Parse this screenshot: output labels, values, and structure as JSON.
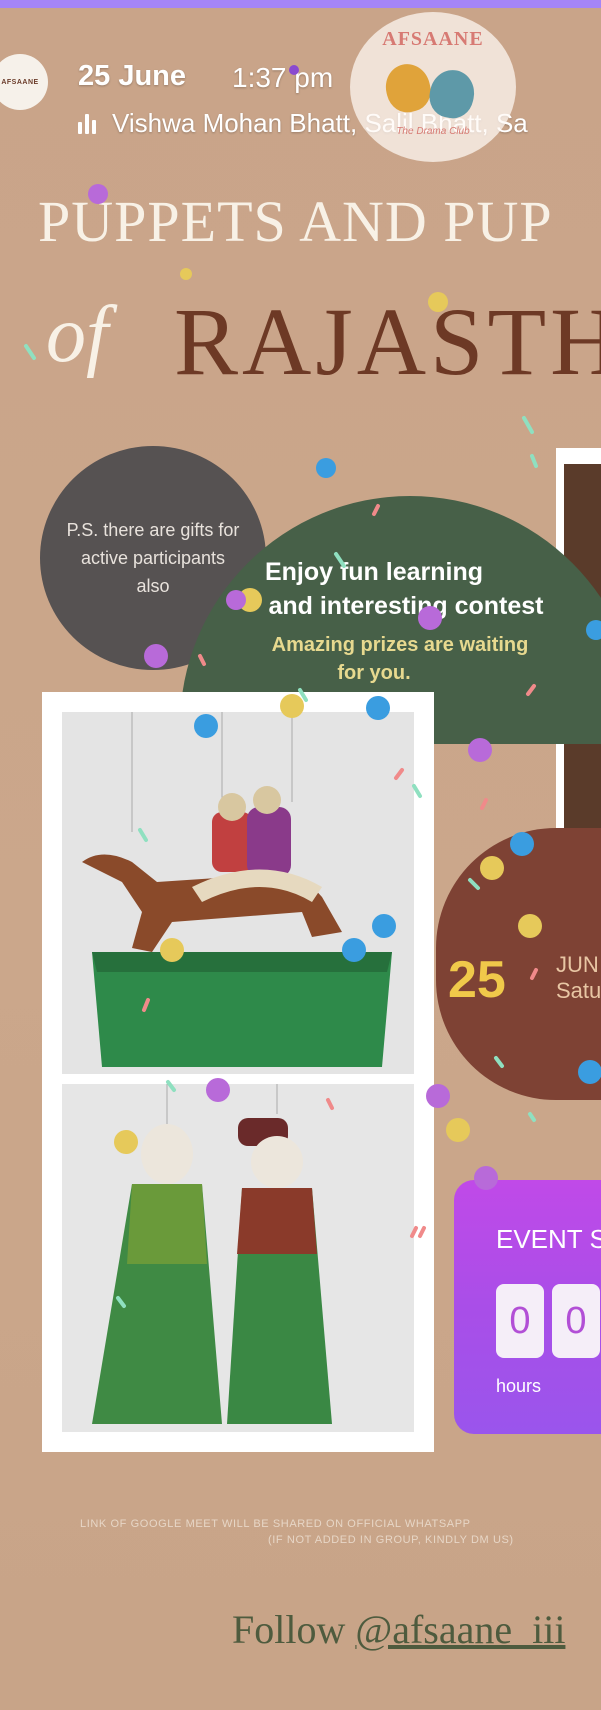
{
  "story": {
    "progress_color": "#a585f6",
    "date": "25 June",
    "time": "1:37 pm",
    "song": "Vishwa Mohan Bhatt, Salil Bhatt, Sa",
    "avatar_text": "AFSAANE"
  },
  "poster": {
    "logo": {
      "name": "AFSAANE",
      "subtitle": "The Drama Club"
    },
    "title_line1": "PUPPETS AND PUP",
    "title_of": "of",
    "title_line2": "RAJASTH",
    "ps_note": "P.S. there are gifts for active participants also",
    "green_panel": {
      "line1": "Enjoy fun learning",
      "line2": "and interesting contest",
      "line3": "Amazing prizes are waiting",
      "line4": "for you."
    },
    "date_panel": {
      "day": "25",
      "month": "JUN",
      "weekday": "Satu"
    },
    "countdown": {
      "title": "EVENT ST",
      "digits": [
        "0",
        "0"
      ],
      "unit": "hours"
    },
    "notice_line1": "LINK OF GOOGLE MEET WILL BE SHARED ON OFFICIAL WHATSAPP",
    "notice_line2": "(IF NOT ADDED IN GROUP, KINDLY DM US)",
    "follow_prefix": "Follow ",
    "follow_handle": "@afsaane_iii"
  },
  "colors": {
    "background": "#c9a489",
    "green_panel": "#476048",
    "ps_circle": "#565252",
    "date_panel": "#7e4234",
    "countdown": "#b04ee8",
    "title_dark": "#6d3925"
  }
}
